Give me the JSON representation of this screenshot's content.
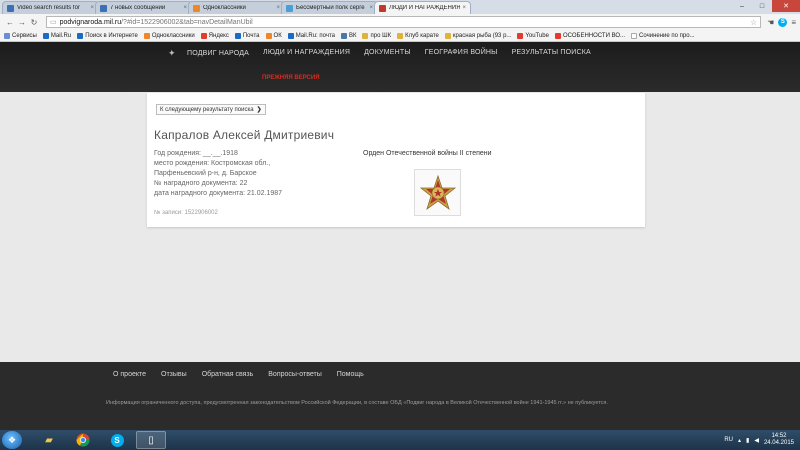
{
  "browser": {
    "tabs": [
      {
        "label": "Video search results for",
        "color": "#3d6fb4",
        "active": false
      },
      {
        "label": "7 новых сообщений",
        "color": "#3d6fb4",
        "active": false
      },
      {
        "label": "Одноклассники",
        "color": "#f0862a",
        "active": false
      },
      {
        "label": "Бессмертный полк серге",
        "color": "#4c9fd6",
        "active": false
      },
      {
        "label": "ЛЮДИ И НАГРАЖДЕНИЯ",
        "color": "#c0392b",
        "active": true
      }
    ],
    "address": {
      "host": "podvignaroda.mil.ru",
      "path": "/?#id=1522906002&tab=navDetailManUbil"
    },
    "bookmarks": [
      {
        "label": "Сервисы",
        "color": "#6b8dd6"
      },
      {
        "label": "Mail.Ru",
        "color": "#1b6bc4"
      },
      {
        "label": "Поиск в Интернете",
        "color": "#1b6bc4"
      },
      {
        "label": "Одноклассники",
        "color": "#f0862a"
      },
      {
        "label": "Яндекс",
        "color": "#e53b2c"
      },
      {
        "label": "Почта",
        "color": "#1b6bc4"
      },
      {
        "label": "ОК",
        "color": "#f0862a"
      },
      {
        "label": "Mail.Ru: почта",
        "color": "#1b6bc4"
      },
      {
        "label": "ВК",
        "color": "#4a76a8"
      },
      {
        "label": "про ШК",
        "color": "#e0b23a"
      },
      {
        "label": "Клуб карате",
        "color": "#e0b23a"
      },
      {
        "label": "красная рыба (93 р...",
        "color": "#e0b23a"
      },
      {
        "label": "YouTube",
        "color": "#e53b2c"
      },
      {
        "label": "ОСОБЕННОСТИ ВО...",
        "color": "#e53b2c"
      },
      {
        "label": "Сочинение по про...",
        "color": "#ffffff"
      }
    ]
  },
  "site": {
    "nav": [
      "ПОДВИГ НАРОДА",
      "ЛЮДИ И НАГРАЖДЕНИЯ",
      "ДОКУМЕНТЫ",
      "ГЕОГРАФИЯ ВОЙНЫ",
      "РЕЗУЛЬТАТЫ ПОИСКА"
    ],
    "old_version": "ПРЕЖНЯЯ ВЕРСИЯ"
  },
  "record": {
    "next_label": "К следующему результату поиска",
    "name": "Капралов Алексей Дмитриевич",
    "lines": [
      "Год рождения: __.__.1918",
      "место рождения: Костромская обл., Парфеньевский р-н, д. Барское",
      "№ наградного документа: 22",
      "дата наградного документа: 21.02.1987"
    ],
    "record_no": "№ записи: 1522906002",
    "award": "Орден Отечественной войны II степени"
  },
  "footer": {
    "nav": [
      "О проекте",
      "Отзывы",
      "Обратная связь",
      "Вопросы-ответы",
      "Помощь"
    ],
    "notice": "Информация ограниченного доступа, предусмотренная законодательством Российской Федерации, в составе ОБД «Подвиг народа в Великой Отечественной войне 1941-1945 гг.» не публикуется."
  },
  "taskbar": {
    "lang": "RU",
    "time": "14:52",
    "date": "24.04.2015"
  }
}
